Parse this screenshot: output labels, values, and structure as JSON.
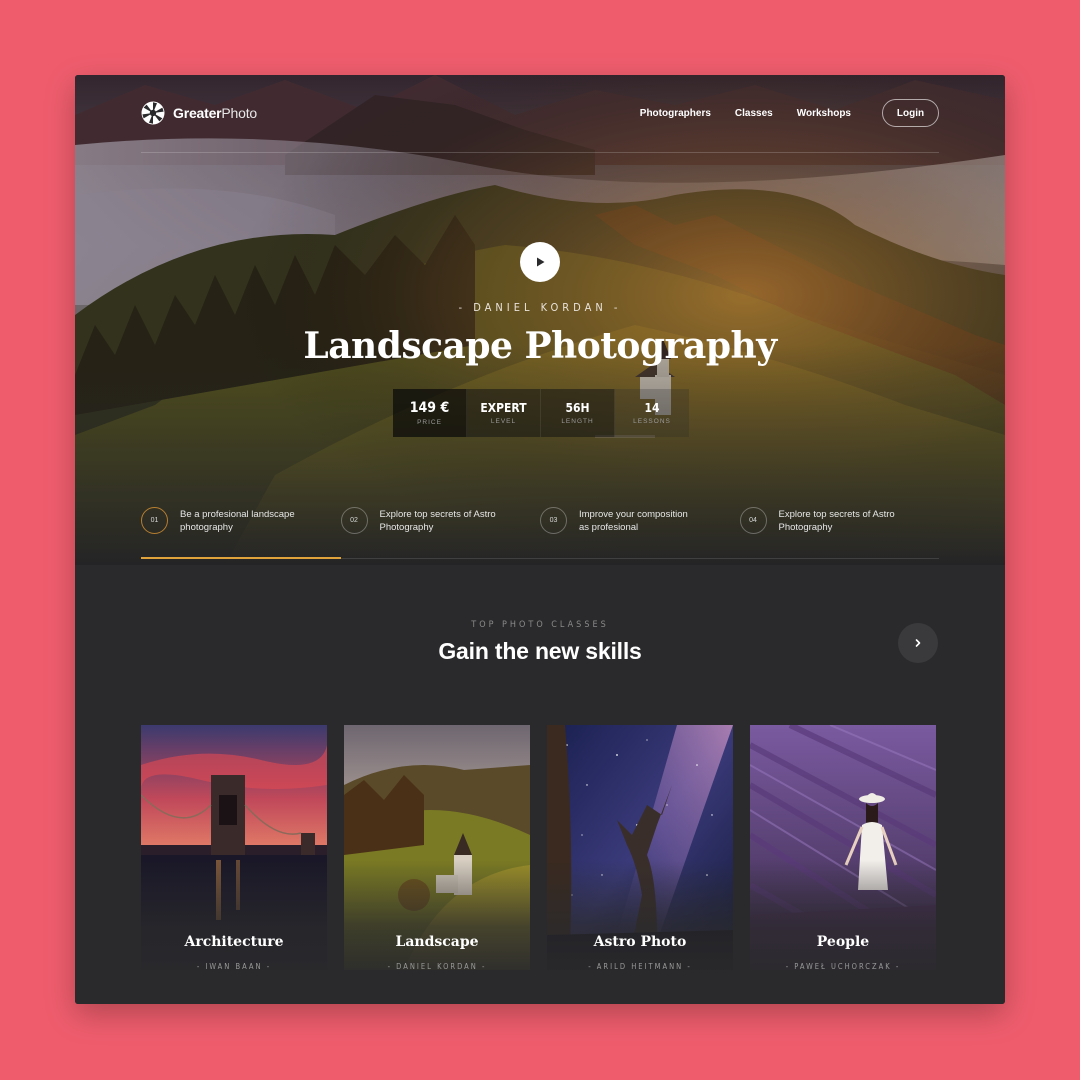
{
  "brand": {
    "name_bold": "Greater",
    "name_light": "Photo",
    "background_color": "#ef5d6d",
    "accent_color": "#e0a23a"
  },
  "nav": {
    "items": [
      "Photographers",
      "Classes",
      "Workshops"
    ],
    "login_label": "Login"
  },
  "hero": {
    "author_line": "- DANIEL KORDAN -",
    "title": "Landscape Photography",
    "play_icon": "play-icon",
    "stats": [
      {
        "value": "149 €",
        "label": "PRICE"
      },
      {
        "value": "EXPERT",
        "label": "LEVEL"
      },
      {
        "value": "56H",
        "label": "LENGTH"
      },
      {
        "value": "14",
        "label": "LESSONS"
      }
    ],
    "features": [
      {
        "num": "01",
        "text": "Be a profesional landscape photography"
      },
      {
        "num": "02",
        "text": "Explore top secrets of Astro Photography"
      },
      {
        "num": "03",
        "text": "Improve your composition as profesional"
      },
      {
        "num": "04",
        "text": "Explore top secrets of Astro Photography"
      }
    ],
    "active_feature_progress": 0.25
  },
  "classes": {
    "eyebrow": "TOP PHOTO CLASSES",
    "title": "Gain the new skills",
    "next_icon": "chevron-right-icon",
    "cards": [
      {
        "title": "Architecture",
        "author": "- IWAN BAAN -"
      },
      {
        "title": "Landscape",
        "author": "- DANIEL KORDAN -"
      },
      {
        "title": "Astro Photo",
        "author": "- ARILD HEITMANN -"
      },
      {
        "title": "People",
        "author": "- PAWEŁ UCHORCZAK -"
      }
    ]
  }
}
